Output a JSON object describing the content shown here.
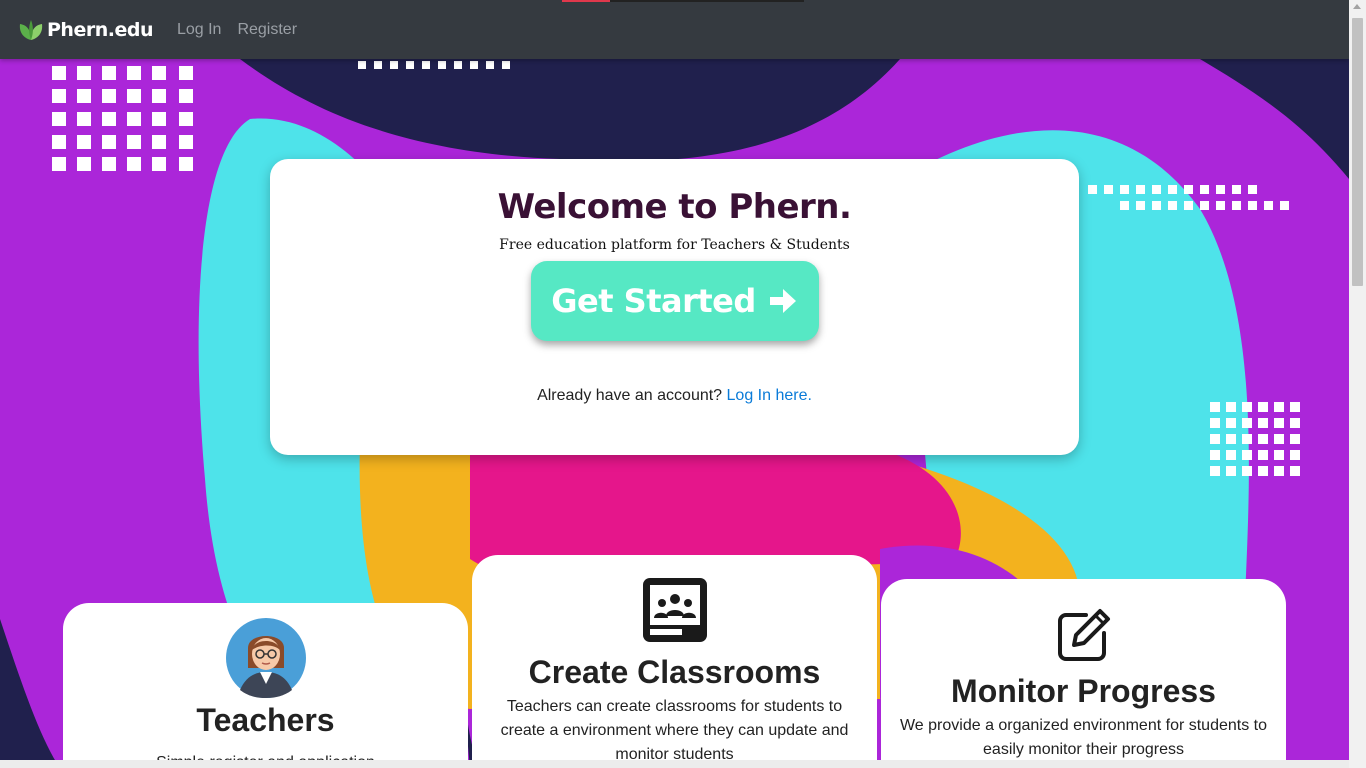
{
  "navbar": {
    "brand": "Phern.edu",
    "links": [
      "Log In",
      "Register"
    ]
  },
  "hero": {
    "title": "Welcome to Phern.",
    "subtitle": "Free education platform for Teachers & Students",
    "cta_label": "Get Started",
    "login_prompt": "Already have an account?",
    "login_link": "Log In here."
  },
  "features": [
    {
      "title": "Teachers",
      "text": "Simple register and application"
    },
    {
      "title": "Create Classrooms",
      "text": "Teachers can create classrooms for students to create a environment where they can update and monitor students"
    },
    {
      "title": "Monitor Progress",
      "text": "We provide a organized environment for students to easily monitor their progress"
    }
  ],
  "colors": {
    "navbar": "#353a40",
    "background": "#ab26d9",
    "cta": "#56e8c4",
    "title": "#3a1135",
    "link": "#0a7bd8"
  },
  "icons": [
    "leaf-logo-icon",
    "arrow-right-icon",
    "teacher-avatar-icon",
    "classroom-icon",
    "edit-icon"
  ]
}
